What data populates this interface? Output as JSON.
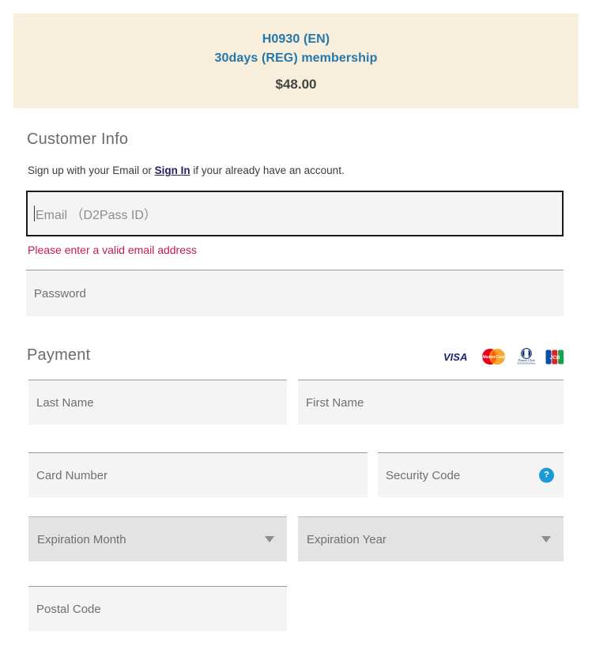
{
  "banner": {
    "product_code": "H0930 (EN)",
    "plan": "30days (REG) membership",
    "price": "$48.00",
    "background_color": "#f7eedb",
    "title_color": "#2577ac",
    "price_color": "#444444"
  },
  "customer_info": {
    "section_title": "Customer Info",
    "note_before_link": "Sign up with your Email or ",
    "signin_link": "Sign In",
    "note_after_link": " if your already have an account.",
    "email": {
      "placeholder": "Email （D2Pass ID）",
      "value": "",
      "focused": true,
      "error": "Please enter a valid email address",
      "error_color": "#c2185b"
    },
    "password": {
      "placeholder": "Password",
      "value": ""
    }
  },
  "payment": {
    "section_title": "Payment",
    "accepted_cards": [
      {
        "name": "visa",
        "label": "VISA"
      },
      {
        "name": "mastercard",
        "label": "MasterCard"
      },
      {
        "name": "diners-club",
        "label": "Diners Club INTERNATIONAL"
      },
      {
        "name": "jcb",
        "label": "JCB"
      }
    ],
    "fields": {
      "last_name": {
        "placeholder": "Last Name",
        "value": ""
      },
      "first_name": {
        "placeholder": "First Name",
        "value": ""
      },
      "card_number": {
        "placeholder": "Card Number",
        "value": ""
      },
      "security_code": {
        "placeholder": "Security Code",
        "value": "",
        "help_glyph": "?"
      },
      "expiration_month": {
        "placeholder": "Expiration Month",
        "value": ""
      },
      "expiration_year": {
        "placeholder": "Expiration Year",
        "value": ""
      },
      "postal_code": {
        "placeholder": "Postal Code",
        "value": ""
      }
    }
  }
}
